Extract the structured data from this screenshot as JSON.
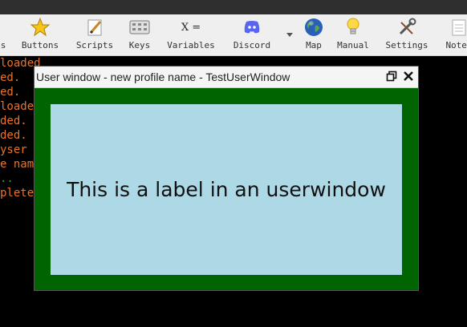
{
  "toolbar": {
    "items": [
      {
        "label": "s",
        "icon": "partial-icon"
      },
      {
        "label": "Buttons",
        "icon": "star-icon"
      },
      {
        "label": "Scripts",
        "icon": "script-pencil-icon"
      },
      {
        "label": "Keys",
        "icon": "keyboard-icon"
      },
      {
        "label": "Variables",
        "icon": "variable-equals-icon"
      },
      {
        "label": "Discord",
        "icon": "discord-icon"
      },
      {
        "label": "",
        "icon": "dropdown-arrow-icon"
      },
      {
        "label": "Map",
        "icon": "globe-icon"
      },
      {
        "label": "Manual",
        "icon": "lightbulb-icon"
      },
      {
        "label": "Settings",
        "icon": "wrench-screwdriver-icon"
      },
      {
        "label": "Notep",
        "icon": "notepad-icon"
      }
    ],
    "variables_glyph": "X ="
  },
  "console": {
    "lines": [
      {
        "text": "  loaded",
        "color": "#e8732a"
      },
      {
        "text": "ed.",
        "color": "#e8732a"
      },
      {
        "text": "ed.",
        "color": "#e8732a"
      },
      {
        "text": "loade",
        "color": "#e8732a"
      },
      {
        "text": "ded.",
        "color": "#e8732a"
      },
      {
        "text": "ded.",
        "color": "#e8732a"
      },
      {
        "text": "yser",
        "color": "#e8732a"
      },
      {
        "text": "e nam",
        "color": "#e8732a"
      },
      {
        "text": "..",
        "color": "#3c9a3c"
      },
      {
        "text": "plete",
        "color": "#e8732a"
      }
    ]
  },
  "userwindow": {
    "title": "User window - new profile name - TestUserWindow",
    "label": "This is a label in an userwindow",
    "colors": {
      "frame": "#006400",
      "label_bg": "#add8e6"
    }
  }
}
